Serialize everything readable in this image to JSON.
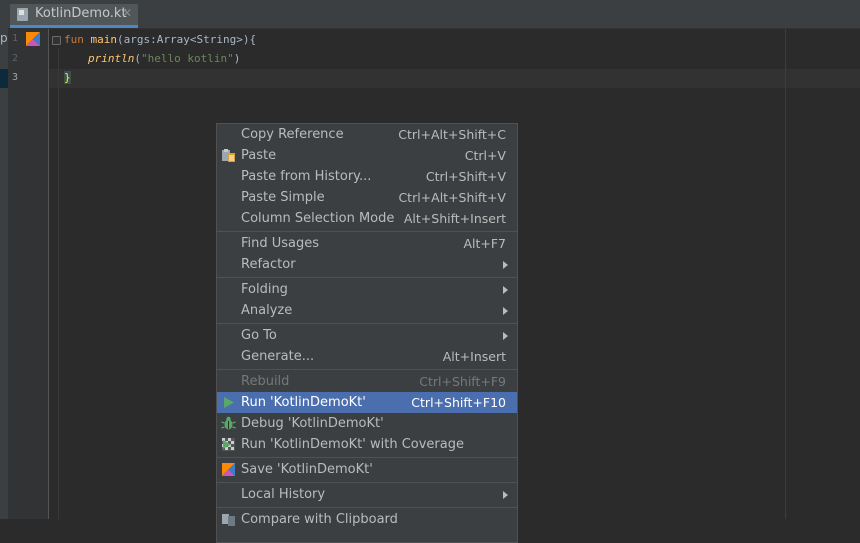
{
  "left_strip": {
    "glyph": "p"
  },
  "tab": {
    "label": "KotlinDemo.kt",
    "close": "✕"
  },
  "gutter": {
    "line_numbers": [
      "1",
      "2",
      "3"
    ]
  },
  "code": {
    "line1": {
      "kw": "fun",
      "name": "main",
      "rest": "(args:Array<String>)",
      "brace": "{"
    },
    "line2": {
      "fn": "println",
      "open": "(",
      "str": "\"hello kotlin\"",
      "close": ")"
    },
    "line3": {
      "brace": "}"
    }
  },
  "menu": {
    "items": [
      {
        "label": "Copy Reference",
        "shortcut": "Ctrl+Alt+Shift+C"
      },
      {
        "label": "Paste",
        "shortcut": "Ctrl+V",
        "icon": "paste-icon"
      },
      {
        "label": "Paste from History...",
        "shortcut": "Ctrl+Shift+V"
      },
      {
        "label": "Paste Simple",
        "shortcut": "Ctrl+Alt+Shift+V"
      },
      {
        "label": "Column Selection Mode",
        "shortcut": "Alt+Shift+Insert"
      },
      {
        "label": "Find Usages",
        "shortcut": "Alt+F7"
      },
      {
        "label": "Refactor",
        "submenu": true
      },
      {
        "label": "Folding",
        "submenu": true
      },
      {
        "label": "Analyze",
        "submenu": true
      },
      {
        "label": "Go To",
        "submenu": true
      },
      {
        "label": "Generate...",
        "shortcut": "Alt+Insert"
      },
      {
        "label": "Rebuild",
        "shortcut": "Ctrl+Shift+F9",
        "disabled": true
      },
      {
        "label": "Run 'KotlinDemoKt'",
        "shortcut": "Ctrl+Shift+F10",
        "icon": "run-icon",
        "selected": true
      },
      {
        "label": "Debug 'KotlinDemoKt'",
        "icon": "debug-icon"
      },
      {
        "label": "Run 'KotlinDemoKt' with Coverage",
        "icon": "coverage-icon"
      },
      {
        "label": "Save 'KotlinDemoKt'",
        "icon": "kotlin-icon"
      },
      {
        "label": "Local History",
        "submenu": true
      },
      {
        "label": "Compare with Clipboard",
        "icon": "compare-icon"
      }
    ]
  },
  "colors": {
    "selection": "#4b6eaf",
    "run_green": "#59a869",
    "kotlin_orange": "#f88909",
    "kotlin_blue": "#3d7cc9"
  }
}
